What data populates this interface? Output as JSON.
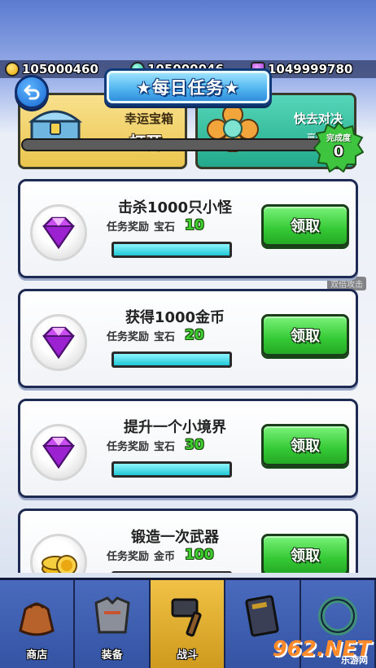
{
  "currencies": [
    {
      "name": "coin",
      "icon": "coin-icon",
      "amount": "105000460"
    },
    {
      "name": "jade",
      "icon": "jade-icon",
      "amount": "105000046"
    },
    {
      "name": "gem",
      "icon": "gem-icon",
      "amount": "1049999780"
    }
  ],
  "title": "★每日任务★",
  "header": {
    "lucky_box": {
      "title": "幸运宝箱",
      "action": "打开"
    },
    "fight": {
      "title": "快去对决",
      "subtitle": "赢取法宝"
    }
  },
  "overall_progress": 0.0,
  "completion": {
    "label": "完成度",
    "value": "0"
  },
  "side_hint": "双倍攻击",
  "tasks": [
    {
      "title": "击杀1000只小怪",
      "reward_label": "任务奖励",
      "reward_type": "宝石",
      "reward_amount": "10",
      "reward_icon": "gem-icon",
      "progress": 1.0,
      "button_label": "领取"
    },
    {
      "title": "获得1000金币",
      "reward_label": "任务奖励",
      "reward_type": "宝石",
      "reward_amount": "20",
      "reward_icon": "gem-icon",
      "progress": 1.0,
      "button_label": "领取"
    },
    {
      "title": "提升一个小境界",
      "reward_label": "任务奖励",
      "reward_type": "宝石",
      "reward_amount": "30",
      "reward_icon": "gem-icon",
      "progress": 1.0,
      "button_label": "领取"
    },
    {
      "title": "锻造一次武器",
      "reward_label": "任务奖励",
      "reward_type": "金币",
      "reward_amount": "100",
      "reward_icon": "coin-stack-icon",
      "progress": 1.0,
      "button_label": "领取"
    }
  ],
  "nav": [
    {
      "label": "商店",
      "icon": "bag-icon",
      "active": false
    },
    {
      "label": "装备",
      "icon": "armor-icon",
      "active": false
    },
    {
      "label": "战斗",
      "icon": "hammer-icon",
      "active": true
    },
    {
      "label": "",
      "icon": "book-icon",
      "active": false
    },
    {
      "label": "",
      "icon": "dragon-icon",
      "active": false
    }
  ],
  "watermark": {
    "main": "962.NET",
    "sub": "乐游网"
  },
  "colors": {
    "claim_green": "#35c935",
    "progress_cyan": "#21c7d6",
    "reward_green": "#3fcf2f",
    "active_tab": "#f0c245"
  }
}
